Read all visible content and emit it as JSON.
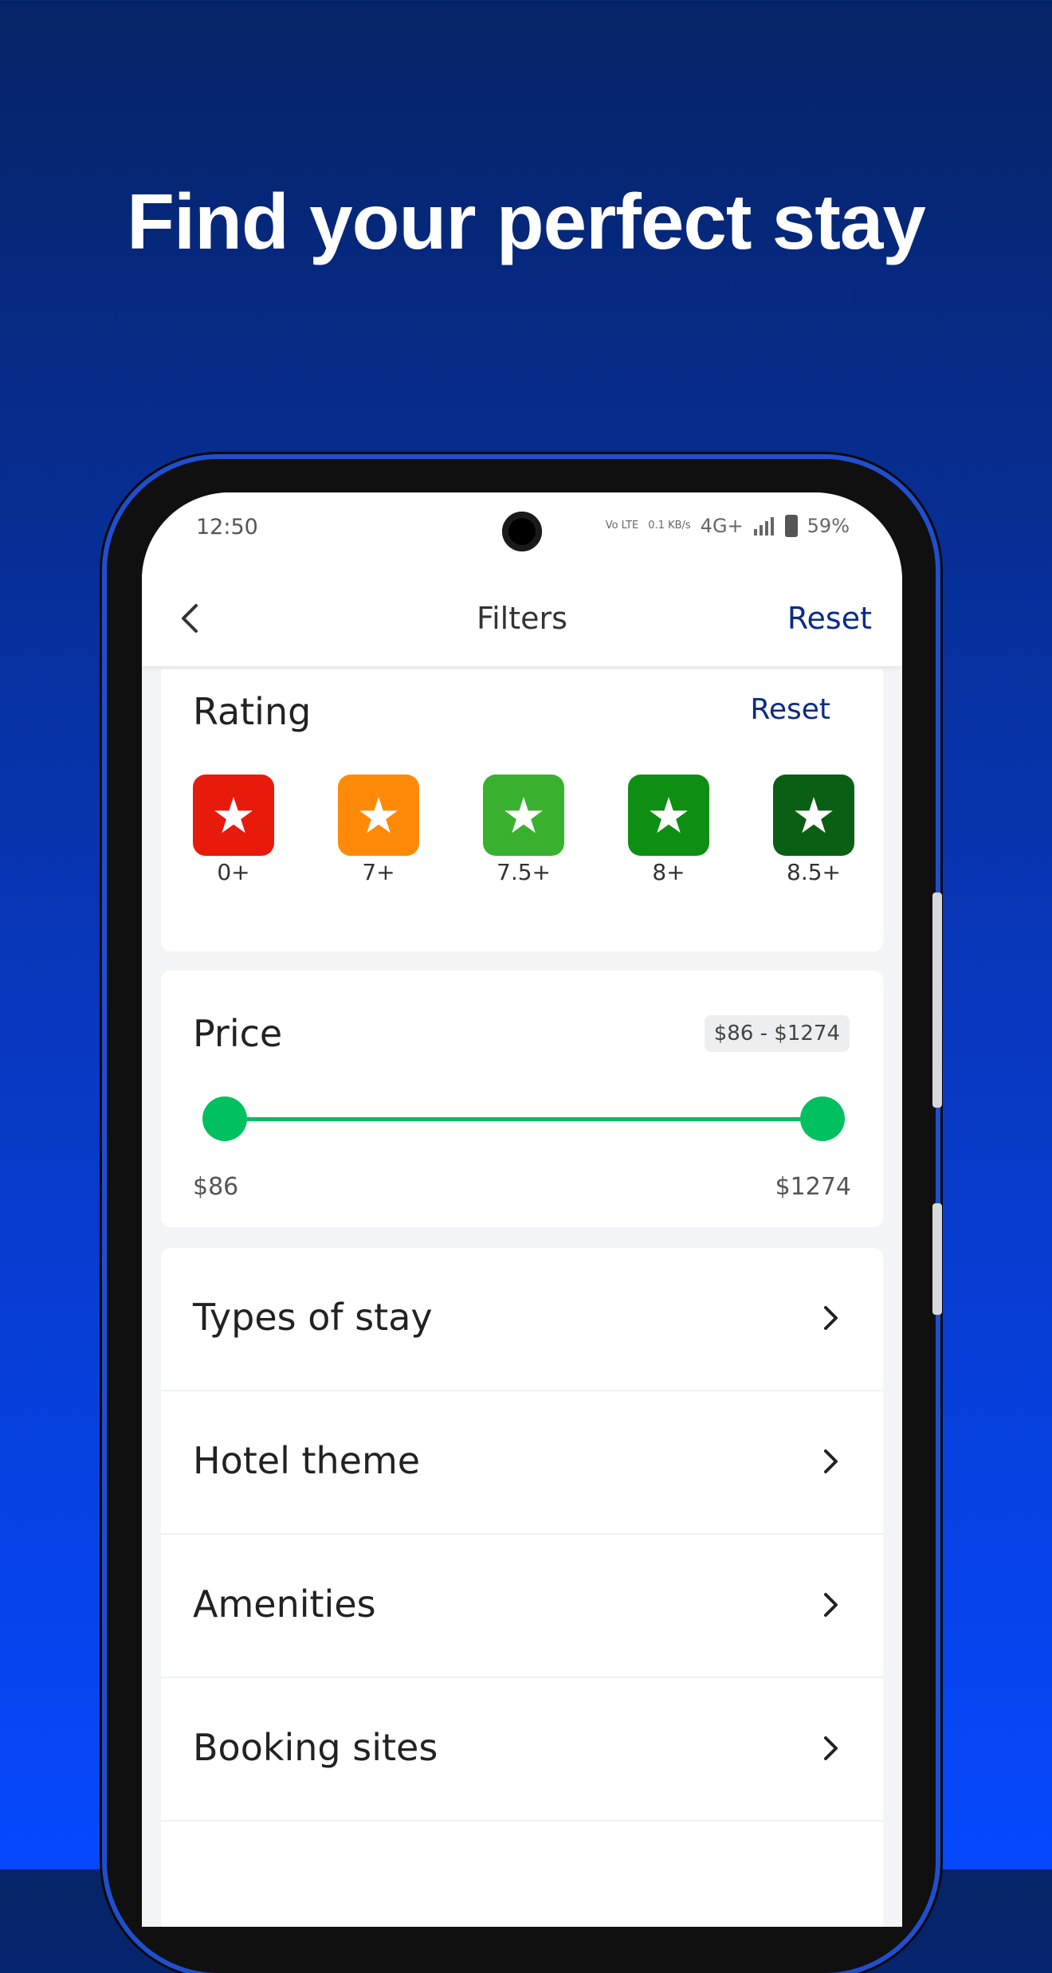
{
  "headline": "Find your perfect stay",
  "status_bar": {
    "time": "12:50",
    "volte": "Vo LTE",
    "speed": "0.1 KB/s",
    "network": "4G+",
    "battery": "59%"
  },
  "topbar": {
    "title": "Filters",
    "reset_label": "Reset"
  },
  "rating": {
    "title": "Rating",
    "reset_label": "Reset",
    "options": [
      {
        "label": "0+",
        "color": "#e81a0c"
      },
      {
        "label": "7+",
        "color": "#ff8a0a"
      },
      {
        "label": "7.5+",
        "color": "#3ab12e"
      },
      {
        "label": "8+",
        "color": "#0e8f14"
      },
      {
        "label": "8.5+",
        "color": "#0b5f14"
      }
    ]
  },
  "price": {
    "title": "Price",
    "range_text": "$86 - $1274",
    "min_label": "$86",
    "max_label": "$1274",
    "slider_color": "#00c060"
  },
  "list": [
    {
      "label": "Types of stay"
    },
    {
      "label": "Hotel theme"
    },
    {
      "label": "Amenities"
    },
    {
      "label": "Booking sites"
    }
  ],
  "accent_color": "#0b2b86"
}
